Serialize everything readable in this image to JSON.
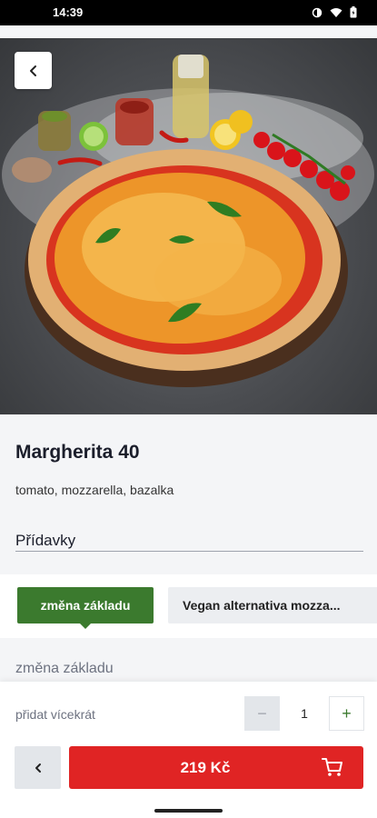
{
  "status": {
    "time": "14:39"
  },
  "product": {
    "name": "Margherita 40",
    "description": "tomato, mozzarella, bazalka"
  },
  "extras": {
    "section_title": "Přídavky",
    "tabs": [
      {
        "label": "změna základu",
        "active": true
      },
      {
        "label": "Vegan alternativa mozza...",
        "active": false
      }
    ],
    "subsection_title": "změna základu"
  },
  "quantity": {
    "label": "přidat vícekrát",
    "value": "1",
    "minus": "−",
    "plus": "+"
  },
  "cart": {
    "price": "219 Kč",
    "icon": "cart-icon"
  },
  "colors": {
    "accent_green": "#3b7a2e",
    "cart_red": "#e02424"
  }
}
